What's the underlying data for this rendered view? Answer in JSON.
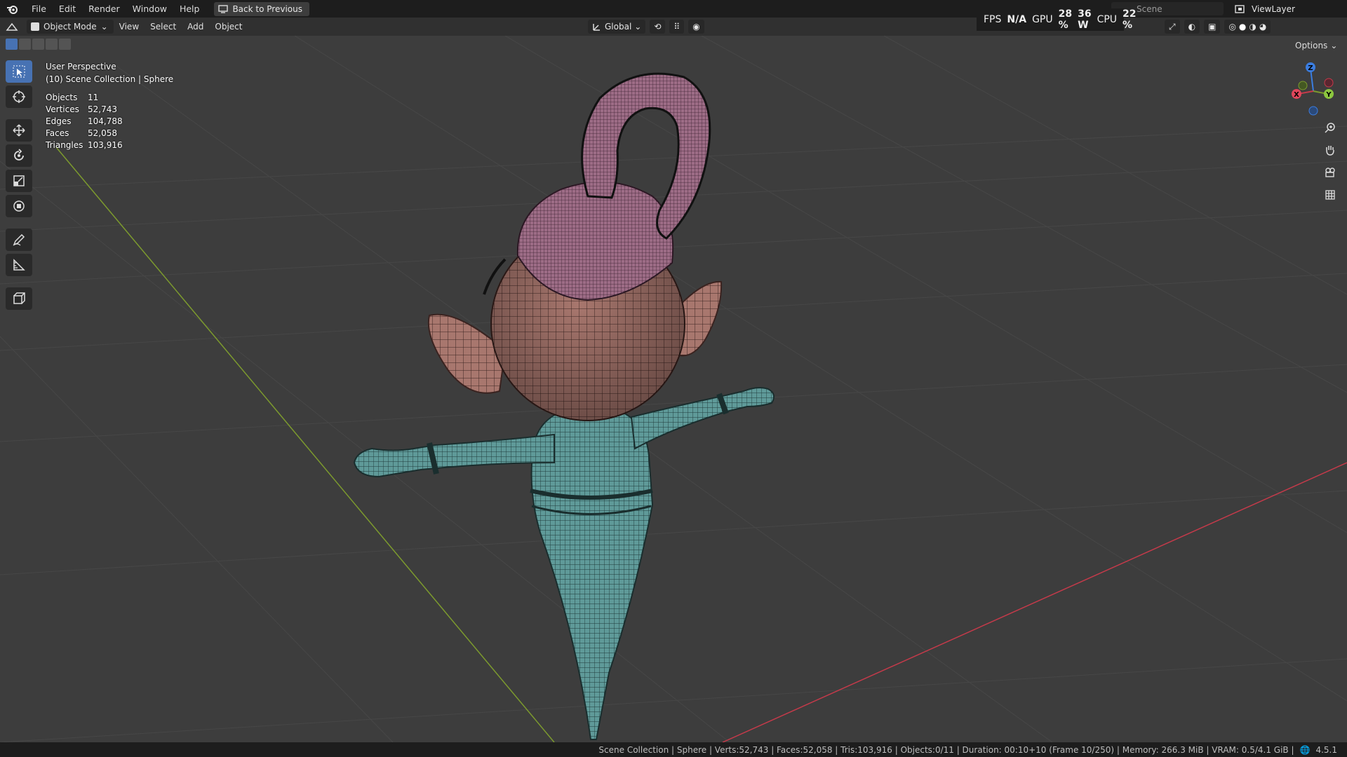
{
  "menu": {
    "items": [
      "File",
      "Edit",
      "Render",
      "Window",
      "Help"
    ],
    "back_button": "Back to Previous"
  },
  "perf": {
    "fps_label": "FPS",
    "fps_value": "N/A",
    "gpu_label": "GPU",
    "gpu_value": "28 %",
    "gpu_power": "36 W",
    "cpu_label": "CPU",
    "cpu_value": "22 %"
  },
  "scene": {
    "name": "Scene",
    "view_layer": "ViewLayer"
  },
  "header": {
    "mode": "Object Mode",
    "menus": [
      "View",
      "Select",
      "Add",
      "Object"
    ],
    "orientation": "Global",
    "options": "Options"
  },
  "overlay": {
    "view_name": "User Perspective",
    "collection": "(10) Scene Collection | Sphere",
    "stats": [
      {
        "label": "Objects",
        "value": "11"
      },
      {
        "label": "Vertices",
        "value": "52,743"
      },
      {
        "label": "Edges",
        "value": "104,788"
      },
      {
        "label": "Faces",
        "value": "52,058"
      },
      {
        "label": "Triangles",
        "value": "103,916"
      }
    ]
  },
  "gizmo": {
    "x": "X",
    "y": "Y",
    "z": "Z"
  },
  "status": {
    "text": "Scene Collection | Sphere | Verts:52,743 | Faces:52,058 | Tris:103,916 | Objects:0/11 | Duration: 00:10+10 (Frame 10/250) | Memory: 266.3 MiB | VRAM: 0.5/4.1 GiB |",
    "version": "4.5.1"
  },
  "colors": {
    "accent": "#4772b3",
    "skin": "#a8776e",
    "hat": "#9d6c86",
    "body": "#5f9a99",
    "x_axis": "#c53a4a",
    "y_axis": "#7c9a2e"
  }
}
